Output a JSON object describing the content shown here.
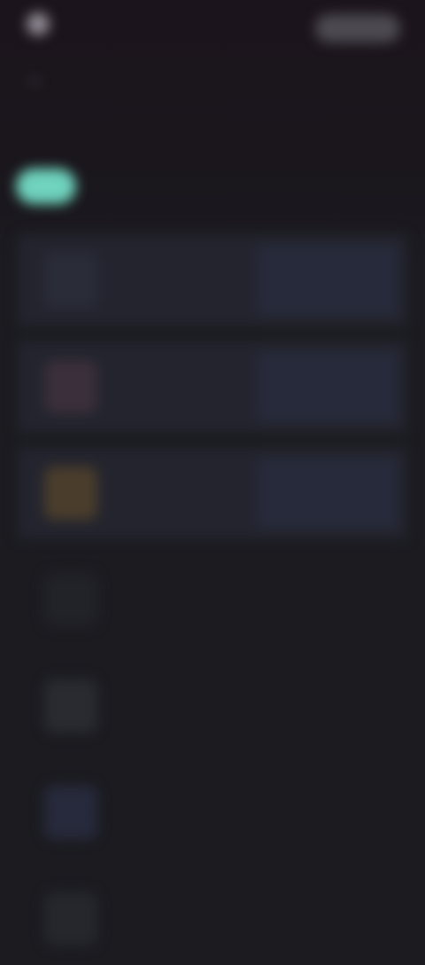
{
  "header": {
    "logo_icon": "logo-icon",
    "logo_text": "",
    "action_label": ""
  },
  "nav": {
    "back_icon": "back-arrow-icon"
  },
  "page": {
    "title": ""
  },
  "tabs": [
    {
      "label": "",
      "active": true
    },
    {
      "label": "",
      "active": false
    },
    {
      "label": "",
      "active": false
    },
    {
      "label": "",
      "active": false
    },
    {
      "label": "",
      "active": false
    }
  ],
  "items": [
    {
      "title": "",
      "subtitle": "",
      "thumb_color": "#2a2c38",
      "highlighted": true
    },
    {
      "title": "",
      "subtitle": "",
      "thumb_color": "#3a2f3a",
      "highlighted": true
    },
    {
      "title": "",
      "subtitle": "",
      "thumb_color": "#4a3d2c",
      "highlighted": true
    },
    {
      "title": "",
      "subtitle": "",
      "thumb_color": "#222229",
      "highlighted": false
    },
    {
      "title": "",
      "subtitle": "",
      "thumb_color": "#2a2b30",
      "highlighted": false
    },
    {
      "title": "",
      "subtitle": "",
      "thumb_color": "#272a3c",
      "highlighted": false
    },
    {
      "title": "",
      "subtitle": "",
      "thumb_color": "#26272d",
      "highlighted": false
    }
  ],
  "colors": {
    "accent": "#6fd3bd",
    "background": "#1b1b20",
    "top_background": "#1c141c"
  }
}
